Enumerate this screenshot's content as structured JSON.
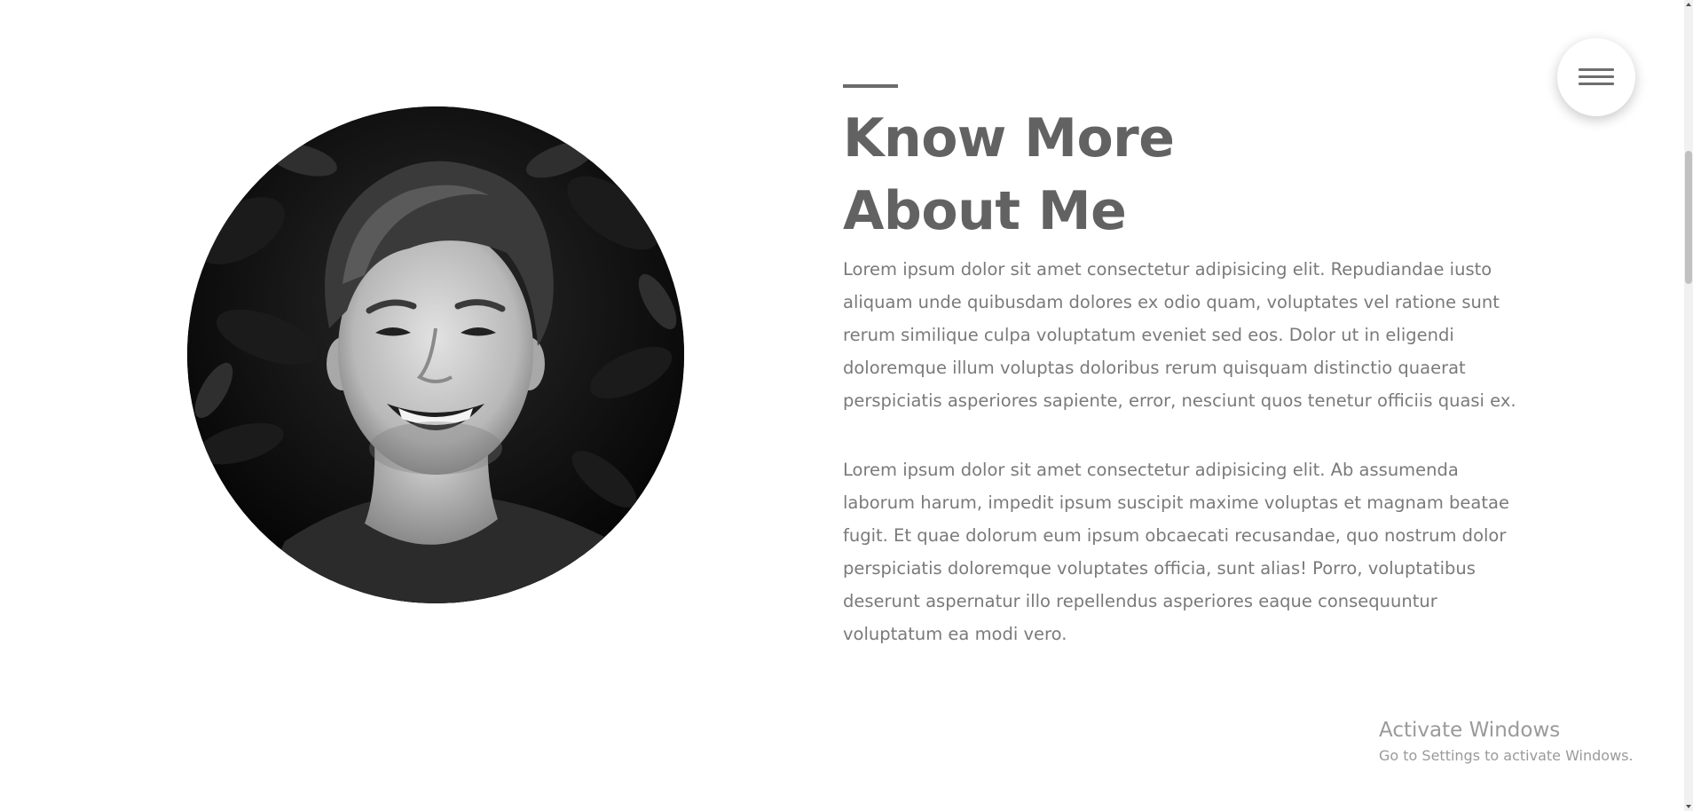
{
  "about": {
    "heading_line1": "Know More",
    "heading_line2": "About Me",
    "paragraph1": "Lorem ipsum dolor sit amet consectetur adipisicing elit. Repudiandae iusto aliquam unde quibusdam dolores ex odio quam, voluptates vel ratione sunt rerum similique culpa voluptatum eveniet sed eos. Dolor ut in eligendi doloremque illum voluptas doloribus rerum quisquam distinctio quaerat perspiciatis asperiores sapiente, error, nesciunt quos tenetur officiis quasi ex.",
    "paragraph2": "Lorem ipsum dolor sit amet consectetur adipisicing elit. Ab assumenda laborum harum, impedit ipsum suscipit maxime voluptas et magnam beatae fugit. Et quae dolorum eum ipsum obcaecati recusandae, quo nostrum dolor perspiciatis doloremque voluptates officia, sunt alias! Porro, voluptatibus deserunt aspernatur illo repellendus asperiores eaque consequuntur voluptatum ea modi vero."
  },
  "menu": {
    "icon": "hamburger-menu-icon"
  },
  "watermark": {
    "title": "Activate Windows",
    "subtitle": "Go to Settings to activate Windows."
  },
  "colors": {
    "heading": "#626262",
    "body_text": "#7a7a7a",
    "accent_line": "#6b6b6b",
    "background": "#ffffff"
  }
}
